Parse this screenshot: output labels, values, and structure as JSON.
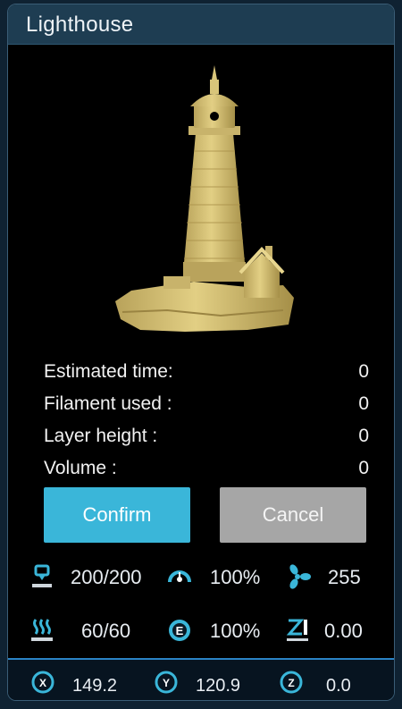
{
  "dialog": {
    "title": "Lighthouse",
    "preview_subject": "lighthouse model"
  },
  "stats": [
    {
      "label": "Estimated time:",
      "value": "0"
    },
    {
      "label": "Filament used :",
      "value": "0"
    },
    {
      "label": "Layer height :",
      "value": "0"
    },
    {
      "label": "Volume :",
      "value": "0"
    }
  ],
  "buttons": {
    "confirm": "Confirm",
    "cancel": "Cancel"
  },
  "status": {
    "nozzle_temp": "200/200",
    "speed": "100%",
    "fan": "255",
    "bed_temp": "60/60",
    "flow": "100%",
    "z_offset": "0.00"
  },
  "position": {
    "x_label": "X",
    "x": "149.2",
    "y_label": "Y",
    "y": "120.9",
    "z_label": "Z",
    "z": "0.0"
  },
  "icons": {
    "nozzle": "nozzle-icon",
    "speed": "gauge-icon",
    "fan": "fan-icon",
    "bed": "heatbed-icon",
    "flow": "extruder-flow-icon",
    "z_offset": "z-offset-icon"
  },
  "colors": {
    "accent": "#3ab6d9",
    "cancel": "#a6a6a6",
    "title_bar": "#1e3d52",
    "model": "#d8c57a"
  }
}
